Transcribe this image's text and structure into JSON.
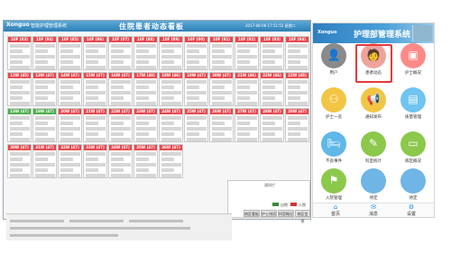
{
  "monitor": {
    "logo": "Xonguo",
    "system_name": "智能护理管理系统",
    "title": "住院患者动态看板",
    "datetime": "2017-08-08 17:51:55 星期二",
    "cards": [
      {
        "head": "10F (83)",
        "color": "red"
      },
      {
        "head": "10F (84)",
        "color": "red"
      },
      {
        "head": "10F (85)",
        "color": "red"
      },
      {
        "head": "10F (86)",
        "color": "red"
      },
      {
        "head": "10F (87)",
        "color": "red"
      },
      {
        "head": "10F (88)",
        "color": "red"
      },
      {
        "head": "10F (89)",
        "color": "red"
      },
      {
        "head": "10F (90)",
        "color": "red"
      },
      {
        "head": "10F (91)",
        "color": "red"
      },
      {
        "head": "10F (92)",
        "color": "red"
      },
      {
        "head": "10F (93)",
        "color": "red"
      },
      {
        "head": "10F (94)",
        "color": "red"
      },
      {
        "head": "12W (45)",
        "color": "red"
      },
      {
        "head": "13W (47)",
        "color": "red"
      },
      {
        "head": "14W (47)",
        "color": "red"
      },
      {
        "head": "15W (47)",
        "color": "red"
      },
      {
        "head": "16W (47)",
        "color": "red"
      },
      {
        "head": "17W (48)",
        "color": "red"
      },
      {
        "head": "18W (46)",
        "color": "red"
      },
      {
        "head": "19W (47)",
        "color": "red"
      },
      {
        "head": "20W (47)",
        "color": "red"
      },
      {
        "head": "21W (46)",
        "color": "red"
      },
      {
        "head": "22W (46)",
        "color": "red"
      },
      {
        "head": "22W (48)",
        "color": "red"
      },
      {
        "head": "13W (47)",
        "color": "green"
      },
      {
        "head": "19W (47)",
        "color": "green"
      },
      {
        "head": "20W (47)",
        "color": "red"
      },
      {
        "head": "21W (47)",
        "color": "red"
      },
      {
        "head": "22W (47)",
        "color": "red"
      },
      {
        "head": "23W (47)",
        "color": "red"
      },
      {
        "head": "24W (47)",
        "color": "red"
      },
      {
        "head": "25W (47)",
        "color": "red"
      },
      {
        "head": "26W (47)",
        "color": "red"
      },
      {
        "head": "27W (47)",
        "color": "red"
      },
      {
        "head": "28W (47)",
        "color": "red"
      },
      {
        "head": "29W (47)",
        "color": "red"
      },
      {
        "head": "30W (47)",
        "color": "red"
      },
      {
        "head": "31W (47)",
        "color": "red"
      },
      {
        "head": "32W (47)",
        "color": "red"
      },
      {
        "head": "33W (47)",
        "color": "red"
      },
      {
        "head": "34W (47)",
        "color": "red"
      },
      {
        "head": "35W (47)",
        "color": "red"
      },
      {
        "head": "36W (47)",
        "color": "red"
      }
    ],
    "notice_label": "通知栏",
    "legend": [
      {
        "label": "出院",
        "color": "#3a8a3a"
      },
      {
        "label": "入院",
        "color": "#d33333"
      }
    ],
    "footer_buttons": [
      "病区看板",
      "护士排班",
      "科室概况",
      "病区信息"
    ]
  },
  "phone": {
    "brand": "Xonguo",
    "title": "护理部管理系统",
    "icons": [
      {
        "label": "用户",
        "icon": "user-icon",
        "glyph": "👤",
        "color": "#8a8a8a"
      },
      {
        "label": "患者动态",
        "icon": "patient-dynamics-icon",
        "glyph": "🧑",
        "color": "#f0a39b"
      },
      {
        "label": "护士概况",
        "icon": "nurse-overview-icon",
        "glyph": "▣",
        "color": "#ff8a88"
      },
      {
        "label": "护士一览",
        "icon": "nurse-list-icon",
        "glyph": "⚇",
        "color": "#f2c544"
      },
      {
        "label": "通知发布",
        "icon": "announcement-icon",
        "glyph": "📢",
        "color": "#f2c544"
      },
      {
        "label": "质量管理",
        "icon": "quality-icon",
        "glyph": "▤",
        "color": "#6fc4f0"
      },
      {
        "label": "不良事件",
        "icon": "adverse-event-icon",
        "glyph": "🛏",
        "color": "#5fb8e8"
      },
      {
        "label": "科室统计",
        "icon": "statistics-icon",
        "glyph": "✎",
        "color": "#8cc84b"
      },
      {
        "label": "病区概况",
        "icon": "ward-icon",
        "glyph": "▭",
        "color": "#8cc84b"
      },
      {
        "label": "入院管理",
        "icon": "admission-icon",
        "glyph": "⚑",
        "color": "#8cc84b"
      },
      {
        "label": "待定",
        "icon": "placeholder-icon",
        "glyph": "",
        "color": "#6fb5e6"
      },
      {
        "label": "待定",
        "icon": "placeholder-icon",
        "glyph": "",
        "color": "#6fb5e6"
      }
    ],
    "nav": [
      {
        "label": "首页",
        "icon": "home-icon",
        "glyph": "⌂"
      },
      {
        "label": "消息",
        "icon": "message-icon",
        "glyph": "✉"
      },
      {
        "label": "设置",
        "icon": "settings-icon",
        "glyph": "⚙"
      }
    ]
  }
}
